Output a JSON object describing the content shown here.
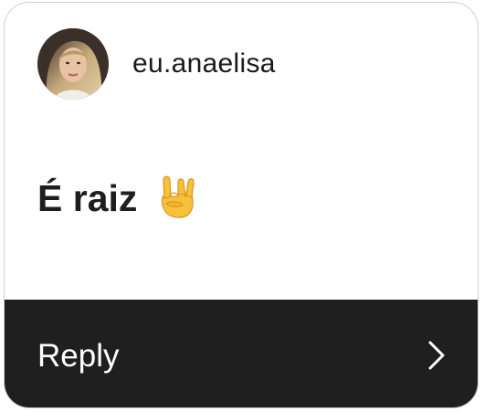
{
  "post": {
    "username": "eu.anaelisa",
    "message": "É raiz",
    "emoji": "sign-of-the-horns-emoji"
  },
  "reply": {
    "label": "Reply",
    "icon": "chevron-right-icon"
  },
  "colors": {
    "reply_bar": "#1f1f1f",
    "text": "#1e1e1e",
    "emoji": "#f5c23a"
  }
}
